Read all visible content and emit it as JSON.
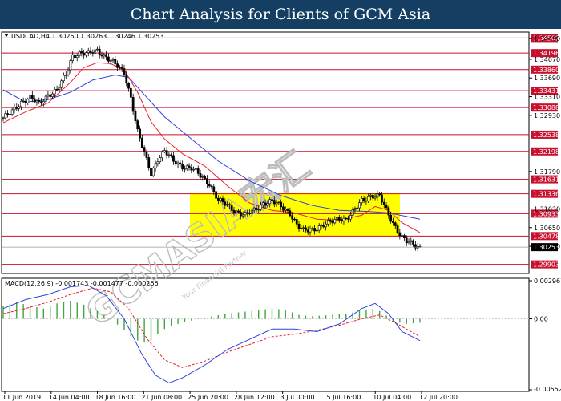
{
  "header": {
    "title": "Chart Analysis for Clients of GCM Asia"
  },
  "watermark": {
    "text": "GCMASIA宏汇",
    "tagline": "Your Financial Partner"
  },
  "colors": {
    "banner": "#143f63",
    "candle": "#000000",
    "ma_fast": "#e8202a",
    "ma_slow": "#2b44e0",
    "levels": "#c8102e",
    "zone": "#ffff00",
    "macd_hist": "#3fa63f",
    "macd_signal": "#e8202a",
    "macd_line": "#2b44e0"
  },
  "chart_data": {
    "type": "candlestick",
    "symbol_info": "USDCAD,H4  1.30260 1.30263 1.30246 1.30253",
    "last_price_label": "1.30253",
    "last_price": 1.30253,
    "ylim": [
      1.2975,
      1.3459
    ],
    "y_ticks": [
      "1.34490",
      "1.34070",
      "1.33690",
      "1.33310",
      "1.32930",
      "1.31790",
      "1.31030",
      "1.30650",
      "1.30270"
    ],
    "x_labels": [
      "11 Jun 2019",
      "14 Jun 04:00",
      "18 Jun 16:00",
      "21 Jun 08:00",
      "25 Jun 20:00",
      "28 Jun 12:00",
      "3 Jul 00:00",
      "5 Jul 16:00",
      "10 Jul 04:00",
      "12 Jul 20:00"
    ],
    "resistance_levels": [
      "1.34502",
      "1.34196",
      "1.33860",
      "1.33431",
      "1.33088",
      "1.32538",
      "1.32198",
      "1.31631",
      "1.31336",
      "1.30933",
      "1.30478",
      "1.29903"
    ],
    "zone": {
      "from": 1.3047,
      "to": 1.3135
    },
    "close_path": [
      [
        0,
        1.3288
      ],
      [
        4,
        1.33
      ],
      [
        8,
        1.332
      ],
      [
        12,
        1.333
      ],
      [
        16,
        1.3315
      ],
      [
        20,
        1.3335
      ],
      [
        24,
        1.3345
      ],
      [
        28,
        1.3375
      ],
      [
        31,
        1.3415
      ],
      [
        34,
        1.342
      ],
      [
        38,
        1.3418
      ],
      [
        42,
        1.3425
      ],
      [
        46,
        1.3412
      ],
      [
        50,
        1.3396
      ],
      [
        54,
        1.338
      ],
      [
        57,
        1.333
      ],
      [
        60,
        1.326
      ],
      [
        63,
        1.3215
      ],
      [
        66,
        1.3175
      ],
      [
        69,
        1.3205
      ],
      [
        72,
        1.322
      ],
      [
        76,
        1.32
      ],
      [
        80,
        1.319
      ],
      [
        84,
        1.3185
      ],
      [
        88,
        1.317
      ],
      [
        92,
        1.3155
      ],
      [
        96,
        1.312
      ],
      [
        100,
        1.311
      ],
      [
        104,
        1.3098
      ],
      [
        108,
        1.309
      ],
      [
        112,
        1.31
      ],
      [
        116,
        1.3115
      ],
      [
        120,
        1.3118
      ],
      [
        124,
        1.3108
      ],
      [
        128,
        1.3095
      ],
      [
        131,
        1.307
      ],
      [
        134,
        1.3058
      ],
      [
        138,
        1.3062
      ],
      [
        142,
        1.3068
      ],
      [
        146,
        1.3075
      ],
      [
        150,
        1.3085
      ],
      [
        153,
        1.3082
      ],
      [
        156,
        1.3095
      ],
      [
        160,
        1.312
      ],
      [
        164,
        1.313
      ],
      [
        168,
        1.3128
      ],
      [
        171,
        1.31
      ],
      [
        174,
        1.3075
      ],
      [
        176,
        1.306
      ],
      [
        178,
        1.3045
      ],
      [
        180,
        1.3036
      ],
      [
        183,
        1.303
      ],
      [
        186,
        1.3025
      ]
    ],
    "ma_fast": [
      [
        0,
        1.3278
      ],
      [
        10,
        1.33
      ],
      [
        20,
        1.3318
      ],
      [
        30,
        1.336
      ],
      [
        36,
        1.339
      ],
      [
        42,
        1.34
      ],
      [
        48,
        1.3398
      ],
      [
        54,
        1.3385
      ],
      [
        60,
        1.334
      ],
      [
        66,
        1.328
      ],
      [
        72,
        1.3245
      ],
      [
        80,
        1.3215
      ],
      [
        90,
        1.319
      ],
      [
        100,
        1.315
      ],
      [
        110,
        1.3115
      ],
      [
        120,
        1.31
      ],
      [
        130,
        1.3095
      ],
      [
        140,
        1.3082
      ],
      [
        150,
        1.308
      ],
      [
        160,
        1.309
      ],
      [
        166,
        1.3108
      ],
      [
        172,
        1.31
      ],
      [
        178,
        1.3075
      ],
      [
        186,
        1.3055
      ]
    ],
    "ma_slow": [
      [
        0,
        1.3345
      ],
      [
        10,
        1.332
      ],
      [
        20,
        1.3325
      ],
      [
        30,
        1.334
      ],
      [
        40,
        1.3365
      ],
      [
        50,
        1.3375
      ],
      [
        56,
        1.337
      ],
      [
        64,
        1.333
      ],
      [
        72,
        1.329
      ],
      [
        84,
        1.3245
      ],
      [
        96,
        1.32
      ],
      [
        110,
        1.316
      ],
      [
        124,
        1.313
      ],
      [
        138,
        1.311
      ],
      [
        150,
        1.31
      ],
      [
        162,
        1.3098
      ],
      [
        172,
        1.3095
      ],
      [
        186,
        1.3082
      ]
    ],
    "macd": {
      "label": "MACD(12,26,9) -0.001743 -0.001477 -0.000266",
      "ylim": [
        -0.005529,
        0.002967
      ],
      "y_ticks": [
        "0.002967",
        "0.00",
        "-0.005529"
      ],
      "histogram": [
        [
          0,
          0.001
        ],
        [
          6,
          0.0013
        ],
        [
          12,
          0.001
        ],
        [
          18,
          0.0008
        ],
        [
          24,
          0.0012
        ],
        [
          30,
          0.0014
        ],
        [
          36,
          0.0011
        ],
        [
          42,
          0.0006
        ],
        [
          46,
          0.0002
        ],
        [
          50,
          -0.0003
        ],
        [
          54,
          -0.0009
        ],
        [
          58,
          -0.0015
        ],
        [
          62,
          -0.0019
        ],
        [
          66,
          -0.0017
        ],
        [
          70,
          -0.001
        ],
        [
          74,
          -0.0006
        ],
        [
          80,
          -0.0003
        ],
        [
          90,
          0.0001
        ],
        [
          100,
          0.0004
        ],
        [
          110,
          0.0006
        ],
        [
          120,
          0.0008
        ],
        [
          126,
          0.0007
        ],
        [
          132,
          0.0003
        ],
        [
          138,
          0.0002
        ],
        [
          146,
          0.0003
        ],
        [
          154,
          0.0004
        ],
        [
          160,
          0.0007
        ],
        [
          166,
          0.0008
        ],
        [
          170,
          0.0004
        ],
        [
          174,
          -0.0002
        ],
        [
          180,
          -0.0004
        ],
        [
          186,
          -0.0003
        ]
      ],
      "signal": [
        [
          0,
          0.0004
        ],
        [
          10,
          0.0008
        ],
        [
          20,
          0.0013
        ],
        [
          30,
          0.0019
        ],
        [
          40,
          0.0024
        ],
        [
          48,
          0.0021
        ],
        [
          56,
          0.0008
        ],
        [
          64,
          -0.0015
        ],
        [
          72,
          -0.0032
        ],
        [
          80,
          -0.0038
        ],
        [
          90,
          -0.0033
        ],
        [
          100,
          -0.0026
        ],
        [
          110,
          -0.002
        ],
        [
          120,
          -0.0014
        ],
        [
          130,
          -0.0012
        ],
        [
          140,
          -0.0009
        ],
        [
          150,
          -0.0005
        ],
        [
          160,
          0.0
        ],
        [
          168,
          0.0003
        ],
        [
          176,
          -0.0004
        ],
        [
          186,
          -0.0014
        ]
      ],
      "macd_line": [
        [
          0,
          0.0008
        ],
        [
          10,
          0.0015
        ],
        [
          20,
          0.0019
        ],
        [
          30,
          0.0025
        ],
        [
          38,
          0.0026
        ],
        [
          46,
          0.0018
        ],
        [
          54,
          0.0
        ],
        [
          62,
          -0.0028
        ],
        [
          68,
          -0.0044
        ],
        [
          74,
          -0.005
        ],
        [
          80,
          -0.0046
        ],
        [
          90,
          -0.0036
        ],
        [
          100,
          -0.0024
        ],
        [
          110,
          -0.0016
        ],
        [
          120,
          -0.0008
        ],
        [
          130,
          -0.0008
        ],
        [
          140,
          -0.001
        ],
        [
          150,
          -0.0004
        ],
        [
          160,
          0.0008
        ],
        [
          166,
          0.0012
        ],
        [
          172,
          0.0004
        ],
        [
          178,
          -0.001
        ],
        [
          186,
          -0.0017
        ]
      ]
    }
  }
}
